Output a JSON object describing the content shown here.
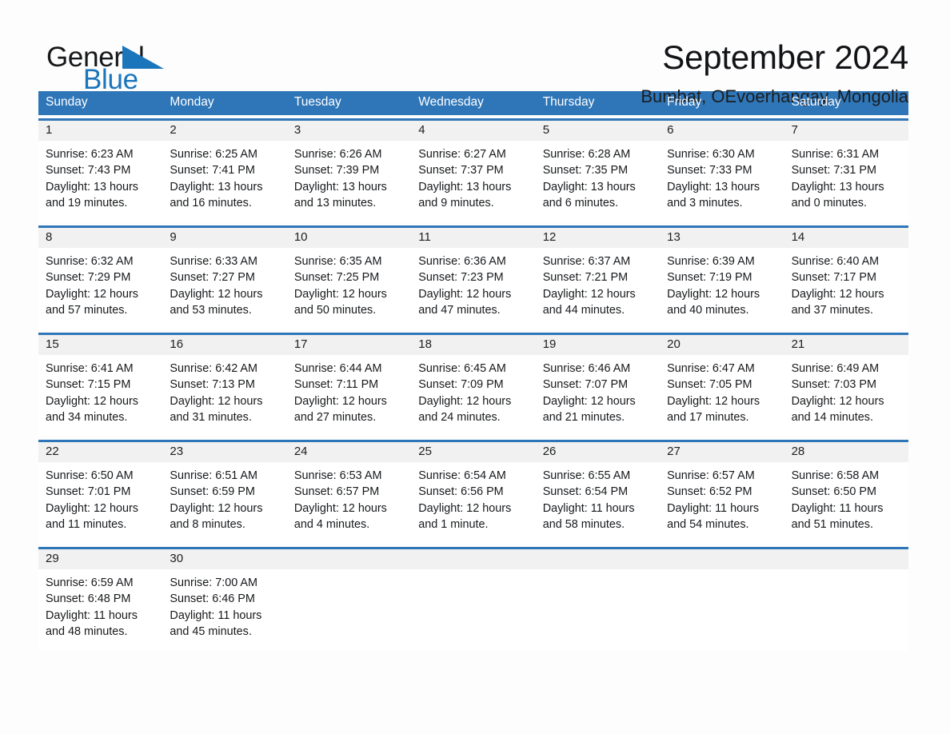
{
  "logo": {
    "word_one": "General",
    "word_two": "Blue",
    "triangle_icon": "triangle-icon",
    "brand_blue": "#1b75bb"
  },
  "header": {
    "title": "September 2024",
    "subtitle": "Bumbat, OEvoerhangay, Mongolia"
  },
  "colors": {
    "header_blue": "#2f76b8",
    "daynum_band": "#f1f1f1",
    "text": "#17191c"
  },
  "weekdays": [
    "Sunday",
    "Monday",
    "Tuesday",
    "Wednesday",
    "Thursday",
    "Friday",
    "Saturday"
  ],
  "weeks": [
    [
      {
        "day": "1",
        "sunrise": "Sunrise: 6:23 AM",
        "sunset": "Sunset: 7:43 PM",
        "daylight1": "Daylight: 13 hours",
        "daylight2": "and 19 minutes."
      },
      {
        "day": "2",
        "sunrise": "Sunrise: 6:25 AM",
        "sunset": "Sunset: 7:41 PM",
        "daylight1": "Daylight: 13 hours",
        "daylight2": "and 16 minutes."
      },
      {
        "day": "3",
        "sunrise": "Sunrise: 6:26 AM",
        "sunset": "Sunset: 7:39 PM",
        "daylight1": "Daylight: 13 hours",
        "daylight2": "and 13 minutes."
      },
      {
        "day": "4",
        "sunrise": "Sunrise: 6:27 AM",
        "sunset": "Sunset: 7:37 PM",
        "daylight1": "Daylight: 13 hours",
        "daylight2": "and 9 minutes."
      },
      {
        "day": "5",
        "sunrise": "Sunrise: 6:28 AM",
        "sunset": "Sunset: 7:35 PM",
        "daylight1": "Daylight: 13 hours",
        "daylight2": "and 6 minutes."
      },
      {
        "day": "6",
        "sunrise": "Sunrise: 6:30 AM",
        "sunset": "Sunset: 7:33 PM",
        "daylight1": "Daylight: 13 hours",
        "daylight2": "and 3 minutes."
      },
      {
        "day": "7",
        "sunrise": "Sunrise: 6:31 AM",
        "sunset": "Sunset: 7:31 PM",
        "daylight1": "Daylight: 13 hours",
        "daylight2": "and 0 minutes."
      }
    ],
    [
      {
        "day": "8",
        "sunrise": "Sunrise: 6:32 AM",
        "sunset": "Sunset: 7:29 PM",
        "daylight1": "Daylight: 12 hours",
        "daylight2": "and 57 minutes."
      },
      {
        "day": "9",
        "sunrise": "Sunrise: 6:33 AM",
        "sunset": "Sunset: 7:27 PM",
        "daylight1": "Daylight: 12 hours",
        "daylight2": "and 53 minutes."
      },
      {
        "day": "10",
        "sunrise": "Sunrise: 6:35 AM",
        "sunset": "Sunset: 7:25 PM",
        "daylight1": "Daylight: 12 hours",
        "daylight2": "and 50 minutes."
      },
      {
        "day": "11",
        "sunrise": "Sunrise: 6:36 AM",
        "sunset": "Sunset: 7:23 PM",
        "daylight1": "Daylight: 12 hours",
        "daylight2": "and 47 minutes."
      },
      {
        "day": "12",
        "sunrise": "Sunrise: 6:37 AM",
        "sunset": "Sunset: 7:21 PM",
        "daylight1": "Daylight: 12 hours",
        "daylight2": "and 44 minutes."
      },
      {
        "day": "13",
        "sunrise": "Sunrise: 6:39 AM",
        "sunset": "Sunset: 7:19 PM",
        "daylight1": "Daylight: 12 hours",
        "daylight2": "and 40 minutes."
      },
      {
        "day": "14",
        "sunrise": "Sunrise: 6:40 AM",
        "sunset": "Sunset: 7:17 PM",
        "daylight1": "Daylight: 12 hours",
        "daylight2": "and 37 minutes."
      }
    ],
    [
      {
        "day": "15",
        "sunrise": "Sunrise: 6:41 AM",
        "sunset": "Sunset: 7:15 PM",
        "daylight1": "Daylight: 12 hours",
        "daylight2": "and 34 minutes."
      },
      {
        "day": "16",
        "sunrise": "Sunrise: 6:42 AM",
        "sunset": "Sunset: 7:13 PM",
        "daylight1": "Daylight: 12 hours",
        "daylight2": "and 31 minutes."
      },
      {
        "day": "17",
        "sunrise": "Sunrise: 6:44 AM",
        "sunset": "Sunset: 7:11 PM",
        "daylight1": "Daylight: 12 hours",
        "daylight2": "and 27 minutes."
      },
      {
        "day": "18",
        "sunrise": "Sunrise: 6:45 AM",
        "sunset": "Sunset: 7:09 PM",
        "daylight1": "Daylight: 12 hours",
        "daylight2": "and 24 minutes."
      },
      {
        "day": "19",
        "sunrise": "Sunrise: 6:46 AM",
        "sunset": "Sunset: 7:07 PM",
        "daylight1": "Daylight: 12 hours",
        "daylight2": "and 21 minutes."
      },
      {
        "day": "20",
        "sunrise": "Sunrise: 6:47 AM",
        "sunset": "Sunset: 7:05 PM",
        "daylight1": "Daylight: 12 hours",
        "daylight2": "and 17 minutes."
      },
      {
        "day": "21",
        "sunrise": "Sunrise: 6:49 AM",
        "sunset": "Sunset: 7:03 PM",
        "daylight1": "Daylight: 12 hours",
        "daylight2": "and 14 minutes."
      }
    ],
    [
      {
        "day": "22",
        "sunrise": "Sunrise: 6:50 AM",
        "sunset": "Sunset: 7:01 PM",
        "daylight1": "Daylight: 12 hours",
        "daylight2": "and 11 minutes."
      },
      {
        "day": "23",
        "sunrise": "Sunrise: 6:51 AM",
        "sunset": "Sunset: 6:59 PM",
        "daylight1": "Daylight: 12 hours",
        "daylight2": "and 8 minutes."
      },
      {
        "day": "24",
        "sunrise": "Sunrise: 6:53 AM",
        "sunset": "Sunset: 6:57 PM",
        "daylight1": "Daylight: 12 hours",
        "daylight2": "and 4 minutes."
      },
      {
        "day": "25",
        "sunrise": "Sunrise: 6:54 AM",
        "sunset": "Sunset: 6:56 PM",
        "daylight1": "Daylight: 12 hours",
        "daylight2": "and 1 minute."
      },
      {
        "day": "26",
        "sunrise": "Sunrise: 6:55 AM",
        "sunset": "Sunset: 6:54 PM",
        "daylight1": "Daylight: 11 hours",
        "daylight2": "and 58 minutes."
      },
      {
        "day": "27",
        "sunrise": "Sunrise: 6:57 AM",
        "sunset": "Sunset: 6:52 PM",
        "daylight1": "Daylight: 11 hours",
        "daylight2": "and 54 minutes."
      },
      {
        "day": "28",
        "sunrise": "Sunrise: 6:58 AM",
        "sunset": "Sunset: 6:50 PM",
        "daylight1": "Daylight: 11 hours",
        "daylight2": "and 51 minutes."
      }
    ],
    [
      {
        "day": "29",
        "sunrise": "Sunrise: 6:59 AM",
        "sunset": "Sunset: 6:48 PM",
        "daylight1": "Daylight: 11 hours",
        "daylight2": "and 48 minutes."
      },
      {
        "day": "30",
        "sunrise": "Sunrise: 7:00 AM",
        "sunset": "Sunset: 6:46 PM",
        "daylight1": "Daylight: 11 hours",
        "daylight2": "and 45 minutes."
      },
      {
        "day": "",
        "sunrise": "",
        "sunset": "",
        "daylight1": "",
        "daylight2": ""
      },
      {
        "day": "",
        "sunrise": "",
        "sunset": "",
        "daylight1": "",
        "daylight2": ""
      },
      {
        "day": "",
        "sunrise": "",
        "sunset": "",
        "daylight1": "",
        "daylight2": ""
      },
      {
        "day": "",
        "sunrise": "",
        "sunset": "",
        "daylight1": "",
        "daylight2": ""
      },
      {
        "day": "",
        "sunrise": "",
        "sunset": "",
        "daylight1": "",
        "daylight2": ""
      }
    ]
  ]
}
